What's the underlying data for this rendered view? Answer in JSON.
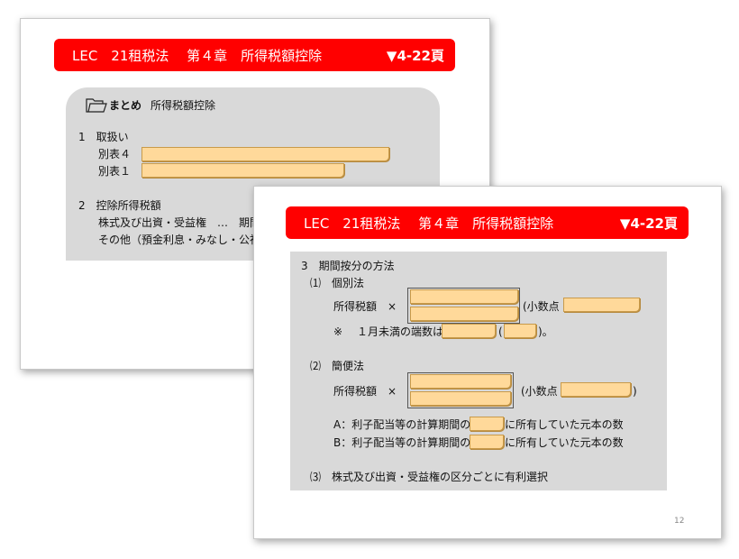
{
  "slide1": {
    "banner": {
      "title": "LEC　21租税法　 第４章　所得税額控除",
      "ref": "▼4-22頁"
    },
    "summary": {
      "label": "まとめ",
      "title": "所得税額控除"
    },
    "s1": {
      "heading": "1　取扱い",
      "row1": "別表４",
      "row2": "別表１"
    },
    "s2": {
      "heading": "2　控除所得税額",
      "line1": "株式及び出資・受益権　…　期間",
      "line2": "その他（預金利息・みなし・公社"
    }
  },
  "slide2": {
    "banner": {
      "title": "LEC　21租税法　 第４章　所得税額控除",
      "ref": "▼4-22頁"
    },
    "s3": {
      "heading": "3　期間按分の方法"
    },
    "p1": {
      "heading": "⑴　個別法",
      "formula_label": "所得税額　×",
      "paren": "(小数点",
      "note_mark": "※",
      "note_text": "１月未満の端数は",
      "paren_open": "(",
      "paren_close": ")。"
    },
    "p2": {
      "heading": "⑵　簡便法",
      "formula_label": "所得税額　×",
      "paren": "(小数点",
      "paren_close": ")",
      "a_prefix": "A：利子配当等の計算期間の",
      "a_suffix": "に所有していた元本の数",
      "b_prefix": "B：利子配当等の計算期間の",
      "b_suffix": "に所有していた元本の数"
    },
    "p3": {
      "heading": "⑶　株式及び出資・受益権の区分ごとに有利選択"
    },
    "page_number": "12"
  }
}
